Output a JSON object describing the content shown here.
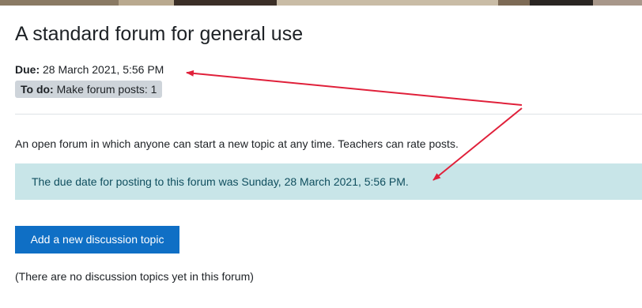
{
  "header": {
    "title": "A standard forum for general use"
  },
  "dates": {
    "due_label": "Due:",
    "due_value": "28 March 2021, 5:56 PM"
  },
  "completion": {
    "todo_label": "To do:",
    "todo_value": "Make forum posts: 1"
  },
  "forum": {
    "intro": "An open forum in which anyone can start a new topic at any time. Teachers can rate posts.",
    "due_notice": "The due date for posting to this forum was Sunday, 28 March 2021, 5:56 PM.",
    "add_button_label": "Add a new discussion topic",
    "empty_message": "(There are no discussion topics yet in this forum)"
  },
  "colors": {
    "accent": "#0f6fc5",
    "notice_background": "#c8e5e8",
    "annotation_arrows": "#e0203a",
    "badge_background": "#ced4da"
  }
}
